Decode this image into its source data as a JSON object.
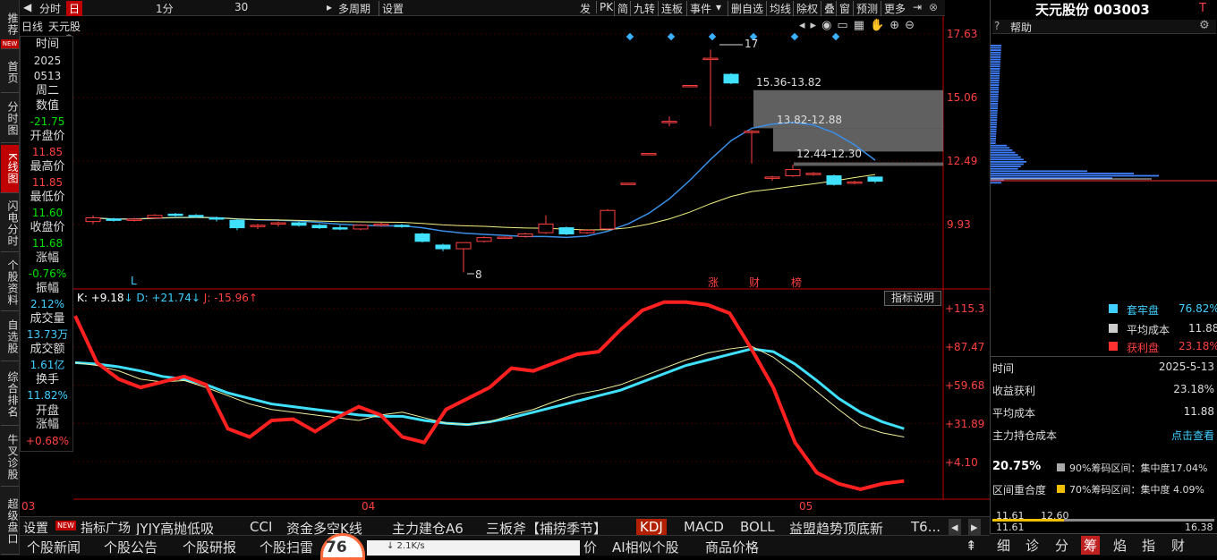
{
  "leftnav": [
    {
      "label": "推荐",
      "badge": "NEW"
    },
    {
      "label": "首页"
    },
    {
      "label": "分时图"
    },
    {
      "label": "K线图"
    },
    {
      "label": "闪电分时"
    },
    {
      "label": "个股资料"
    },
    {
      "label": "自选股"
    },
    {
      "label": "综合排名"
    },
    {
      "label": "牛叉诊股"
    },
    {
      "label": "超级盘口"
    }
  ],
  "toolbar": {
    "items": [
      "分时",
      "日",
      "1分",
      "30",
      "多周期",
      "设置",
      "发",
      "PK",
      "简",
      "九转",
      "连板",
      "事件",
      "删自选",
      "均线",
      "除权",
      "叠",
      "窗",
      "预测",
      "更多"
    ]
  },
  "chart_header": {
    "period": "日线",
    "stock": "天元股"
  },
  "info": {
    "time_label": "时间",
    "year": "2025",
    "date": "0513",
    "weekday": "周二",
    "value_label": "数值",
    "value": "-21.75",
    "open_label": "开盘价",
    "open": "11.85",
    "high_label": "最高价",
    "high": "11.85",
    "low_label": "最低价",
    "low": "11.60",
    "close_label": "收盘价",
    "close": "11.68",
    "chg_label": "涨幅",
    "chg": "-0.76%",
    "amp_label": "振幅",
    "amp": "2.12%",
    "vol_label": "成交量",
    "vol": "13.73万",
    "amt_label": "成交额",
    "amt": "1.61亿",
    "turn_label": "换手",
    "turn": "11.82%",
    "openchg_label": "开盘涨幅",
    "openchg": "+0.68%"
  },
  "price_axis": [
    "17.63",
    "15.06",
    "12.49",
    "9.93"
  ],
  "kdj_axis": [
    "+115.3",
    "+87.47",
    "+59.68",
    "+31.89",
    "+4.10"
  ],
  "x_axis": [
    "03",
    "04",
    "05"
  ],
  "kdj_legend": {
    "k": "K: +9.18",
    "d": "D: +21.74",
    "j": "J: -15.96",
    "explain": "指标说明"
  },
  "annotations": {
    "hi": "17",
    "lo": "8",
    "r1": "15.36-13.82",
    "r2": "13.82-12.88",
    "r3": "12.44-12.30",
    "zhang": "涨",
    "cai": "财",
    "bang": "榜",
    "L": "L"
  },
  "right": {
    "title": "天元股份 003003",
    "help": "帮助",
    "tao": "套牢盘",
    "tao_v": "76.82%",
    "avg": "平均成本",
    "avg_v": "11.88",
    "profit": "获利盘",
    "profit_v": "23.18%",
    "time_l": "时间",
    "time_v": "2025-5-13",
    "pp_l": "收益获利",
    "pp_v": "23.18%",
    "ac_l": "平均成本",
    "ac_v": "11.88",
    "main_l": "主力持仓成本",
    "main_v": "点击查看",
    "big": "20.75%",
    "c90": "90%筹码区间：集中度17.04%",
    "overlap": "区间重合度",
    "c70": "70%筹码区间：集中度 4.09%",
    "lo1": "11.61",
    "lo2": "12.60",
    "lo3": "11.61",
    "hi3": "16.38",
    "tabs": [
      "细",
      "诊",
      "分",
      "筹",
      "焰",
      "指",
      "财"
    ]
  },
  "tabs": [
    "设置",
    "指标广场",
    "JYJY高抛低吸",
    "CCI",
    "资金多空K线",
    "主力建仓A6",
    "三板斧【捕捞季节】",
    "KDJ",
    "MACD",
    "BOLL",
    "益盟趋势顶底新",
    "T6..."
  ],
  "bottom": [
    "个股新闻",
    "个股公告",
    "个股研报",
    "个股扫雷",
    "价",
    "AI相似个股",
    "商品价格"
  ],
  "colors": {
    "up": "#ff4040",
    "down": "#40e0ff",
    "ma_blue": "#3a8ee6",
    "ma_yellow": "#f0f080"
  },
  "candles": [
    {
      "o": 10.05,
      "h": 10.3,
      "l": 9.95,
      "c": 10.2
    },
    {
      "o": 10.15,
      "h": 10.2,
      "l": 10.05,
      "c": 10.1
    },
    {
      "o": 10.1,
      "h": 10.2,
      "l": 10.05,
      "c": 10.15
    },
    {
      "o": 10.2,
      "h": 10.35,
      "l": 10.15,
      "c": 10.3
    },
    {
      "o": 10.35,
      "h": 10.4,
      "l": 10.25,
      "c": 10.3
    },
    {
      "o": 10.3,
      "h": 10.35,
      "l": 10.2,
      "c": 10.25
    },
    {
      "o": 10.2,
      "h": 10.25,
      "l": 10.05,
      "c": 10.15
    },
    {
      "o": 10.1,
      "h": 10.15,
      "l": 9.7,
      "c": 9.8
    },
    {
      "o": 9.85,
      "h": 9.95,
      "l": 9.75,
      "c": 9.9
    },
    {
      "o": 9.95,
      "h": 10.05,
      "l": 9.85,
      "c": 10.0
    },
    {
      "o": 10.0,
      "h": 10.05,
      "l": 9.85,
      "c": 9.9
    },
    {
      "o": 9.9,
      "h": 9.95,
      "l": 9.75,
      "c": 9.8
    },
    {
      "o": 9.8,
      "h": 9.9,
      "l": 9.7,
      "c": 9.75
    },
    {
      "o": 9.75,
      "h": 9.95,
      "l": 9.7,
      "c": 9.9
    },
    {
      "o": 9.9,
      "h": 10.0,
      "l": 9.85,
      "c": 9.95
    },
    {
      "o": 9.9,
      "h": 9.95,
      "l": 9.8,
      "c": 9.85
    },
    {
      "o": 9.55,
      "h": 9.6,
      "l": 9.2,
      "c": 9.25
    },
    {
      "o": 9.1,
      "h": 9.15,
      "l": 8.85,
      "c": 8.95
    },
    {
      "o": 8.95,
      "h": 9.2,
      "l": 8.0,
      "c": 9.2
    },
    {
      "o": 9.25,
      "h": 9.45,
      "l": 9.2,
      "c": 9.4
    },
    {
      "o": 9.4,
      "h": 9.45,
      "l": 9.35,
      "c": 9.42
    },
    {
      "o": 9.45,
      "h": 9.6,
      "l": 9.4,
      "c": 9.55
    },
    {
      "o": 9.6,
      "h": 10.3,
      "l": 9.55,
      "c": 9.95
    },
    {
      "o": 9.8,
      "h": 9.85,
      "l": 9.5,
      "c": 9.55
    },
    {
      "o": 9.6,
      "h": 9.75,
      "l": 9.55,
      "c": 9.7
    },
    {
      "o": 9.75,
      "h": 10.55,
      "l": 9.7,
      "c": 10.5
    },
    {
      "o": 11.6,
      "h": 11.6,
      "l": 11.6,
      "c": 11.6
    },
    {
      "o": 12.8,
      "h": 12.8,
      "l": 12.8,
      "c": 12.8
    },
    {
      "o": 14.1,
      "h": 14.3,
      "l": 13.9,
      "c": 14.1
    },
    {
      "o": 15.55,
      "h": 15.55,
      "l": 15.55,
      "c": 15.55
    },
    {
      "o": 16.65,
      "h": 17.0,
      "l": 13.9,
      "c": 16.65
    },
    {
      "o": 16.0,
      "h": 16.05,
      "l": 15.6,
      "c": 15.65
    },
    {
      "o": 13.7,
      "h": 13.75,
      "l": 12.4,
      "c": 13.7
    },
    {
      "o": 11.8,
      "h": 11.9,
      "l": 11.7,
      "c": 11.85
    },
    {
      "o": 11.9,
      "h": 12.35,
      "l": 11.85,
      "c": 12.15
    },
    {
      "o": 11.95,
      "h": 12.05,
      "l": 11.9,
      "c": 12.0
    },
    {
      "o": 11.9,
      "h": 11.95,
      "l": 11.5,
      "c": 11.55
    },
    {
      "o": 11.6,
      "h": 11.7,
      "l": 11.55,
      "c": 11.65
    },
    {
      "o": 11.85,
      "h": 11.85,
      "l": 11.6,
      "c": 11.68
    }
  ]
}
